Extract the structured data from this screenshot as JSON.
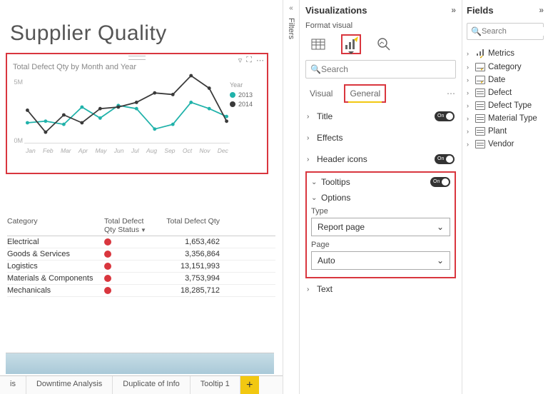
{
  "report_title": "Supplier Quality",
  "chart": {
    "title": "Total Defect Qty by Month and Year",
    "y_ticks": [
      "5M",
      "0M"
    ],
    "x_ticks": [
      "Jan",
      "Feb",
      "Mar",
      "Apr",
      "May",
      "Jun",
      "Jul",
      "Aug",
      "Sep",
      "Oct",
      "Nov",
      "Dec"
    ],
    "legend_title": "Year",
    "legend": [
      {
        "label": "2013",
        "color": "#20b2aa"
      },
      {
        "label": "2014",
        "color": "#3a3a3a"
      }
    ]
  },
  "chart_data": {
    "type": "line",
    "title": "Total Defect Qty by Month and Year",
    "xlabel": "",
    "ylabel": "",
    "ylim": [
      0,
      6000000
    ],
    "categories": [
      "Jan",
      "Feb",
      "Mar",
      "Apr",
      "May",
      "Jun",
      "Jul",
      "Aug",
      "Sep",
      "Oct",
      "Nov",
      "Dec"
    ],
    "series": [
      {
        "name": "2013",
        "color": "#20b2aa",
        "values": [
          1600000,
          1700000,
          1500000,
          2800000,
          2000000,
          2900000,
          2700000,
          1200000,
          1500000,
          3200000,
          2700000,
          2200000
        ]
      },
      {
        "name": "2014",
        "color": "#3a3a3a",
        "values": [
          2500000,
          900000,
          2100000,
          1600000,
          2700000,
          2800000,
          3200000,
          4000000,
          3800000,
          5600000,
          4300000,
          1800000
        ]
      }
    ]
  },
  "table": {
    "headers": {
      "category": "Category",
      "status": "Total Defect Qty Status",
      "qty": "Total Defect Qty"
    },
    "rows": [
      {
        "category": "Electrical",
        "qty": "1,653,462"
      },
      {
        "category": "Goods & Services",
        "qty": "3,356,864"
      },
      {
        "category": "Logistics",
        "qty": "13,151,993"
      },
      {
        "category": "Materials & Components",
        "qty": "3,753,994"
      },
      {
        "category": "Mechanicals",
        "qty": "18,285,712"
      }
    ]
  },
  "page_tabs": [
    "is",
    "Downtime Analysis",
    "Duplicate of Info",
    "Tooltip 1"
  ],
  "filters_label": "Filters",
  "viz": {
    "title": "Visualizations",
    "subtitle": "Format visual",
    "search_placeholder": "Search",
    "tabs": {
      "visual": "Visual",
      "general": "General"
    },
    "sections": {
      "title": "Title",
      "effects": "Effects",
      "header": "Header icons",
      "tooltips": "Tooltips",
      "text": "Text"
    },
    "toggle_on": "On",
    "options": {
      "heading": "Options",
      "type_label": "Type",
      "type_value": "Report page",
      "page_label": "Page",
      "page_value": "Auto"
    }
  },
  "fields": {
    "title": "Fields",
    "search_placeholder": "Search",
    "items": [
      "Metrics",
      "Category",
      "Date",
      "Defect",
      "Defect Type",
      "Material Type",
      "Plant",
      "Vendor"
    ]
  }
}
